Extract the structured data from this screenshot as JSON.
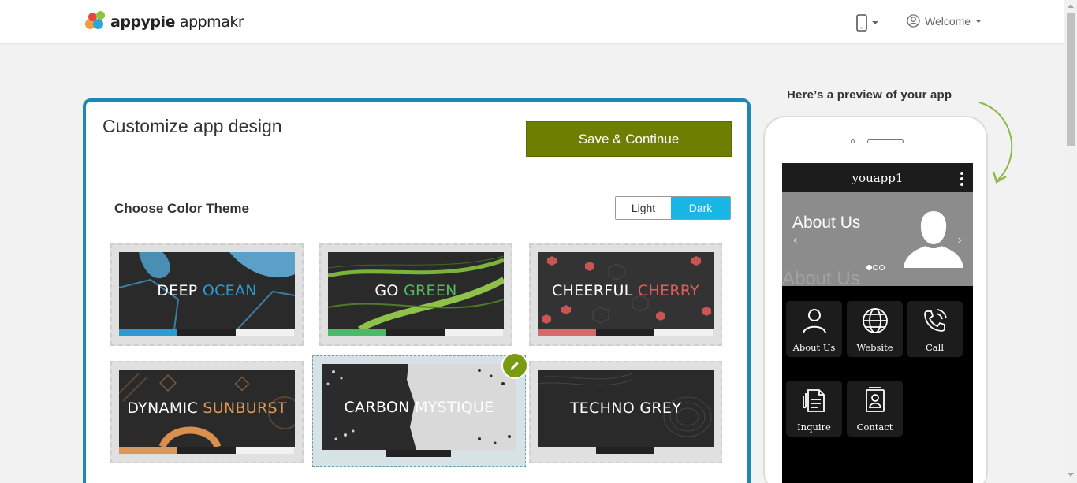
{
  "header": {
    "brand": "appypie",
    "product": "appmakr",
    "welcome_label": "Welcome"
  },
  "panel": {
    "title": "Customize app design",
    "save_label": "Save & Continue",
    "theme_label": "Choose Color Theme",
    "toggle": {
      "light": "Light",
      "dark": "Dark",
      "selected": "Dark"
    }
  },
  "themes": [
    {
      "word1": "DEEP",
      "word2": "OCEAN",
      "accent": "#2e9ad0",
      "bars": [
        "#2e9ad0",
        "#222222",
        "#f2f2f2"
      ]
    },
    {
      "word1": "GO",
      "word2": "GREEN",
      "accent": "#58b85e",
      "bars": [
        "#4db86a",
        "#222222",
        "#f2f2f2"
      ]
    },
    {
      "word1": "CHEERFUL",
      "word2": "CHERRY",
      "accent": "#e35c5c",
      "bars": [
        "#d36b6b",
        "#222222",
        "#f2f2f2"
      ]
    },
    {
      "word1": "DYNAMIC",
      "word2": "SUNBURST",
      "accent": "#e59a4e",
      "bars": [
        "#d9975a",
        "#222222",
        "#f2f2f2"
      ]
    },
    {
      "word1": "CARBON",
      "word2": "MYSTIQUE",
      "accent": "#ffffff",
      "bars": [
        "#d6e2e6",
        "#222222",
        "#d6e2e6"
      ],
      "selected": true
    },
    {
      "word1": "TECHNO",
      "word2": "GREY",
      "accent": "#ffffff",
      "bars": [
        "#e0e0e0",
        "#222222",
        "#e0e0e0"
      ]
    }
  ],
  "preview": {
    "label": "Here’s a preview of your app",
    "app_name": "youapp1",
    "banner_title": "About Us",
    "banner_ghost": "About Us",
    "tiles": [
      {
        "label": "About Us",
        "icon": "person-icon"
      },
      {
        "label": "Website",
        "icon": "globe-icon"
      },
      {
        "label": "Call",
        "icon": "phone-call-icon"
      },
      {
        "label": "Inquire",
        "icon": "document-icon"
      },
      {
        "label": "Contact",
        "icon": "contact-book-icon"
      }
    ]
  },
  "colors": {
    "panel_border": "#1e87b4",
    "save_button": "#6e7e00",
    "toggle_active": "#19b6e6",
    "edit_badge": "#7a9a12"
  }
}
